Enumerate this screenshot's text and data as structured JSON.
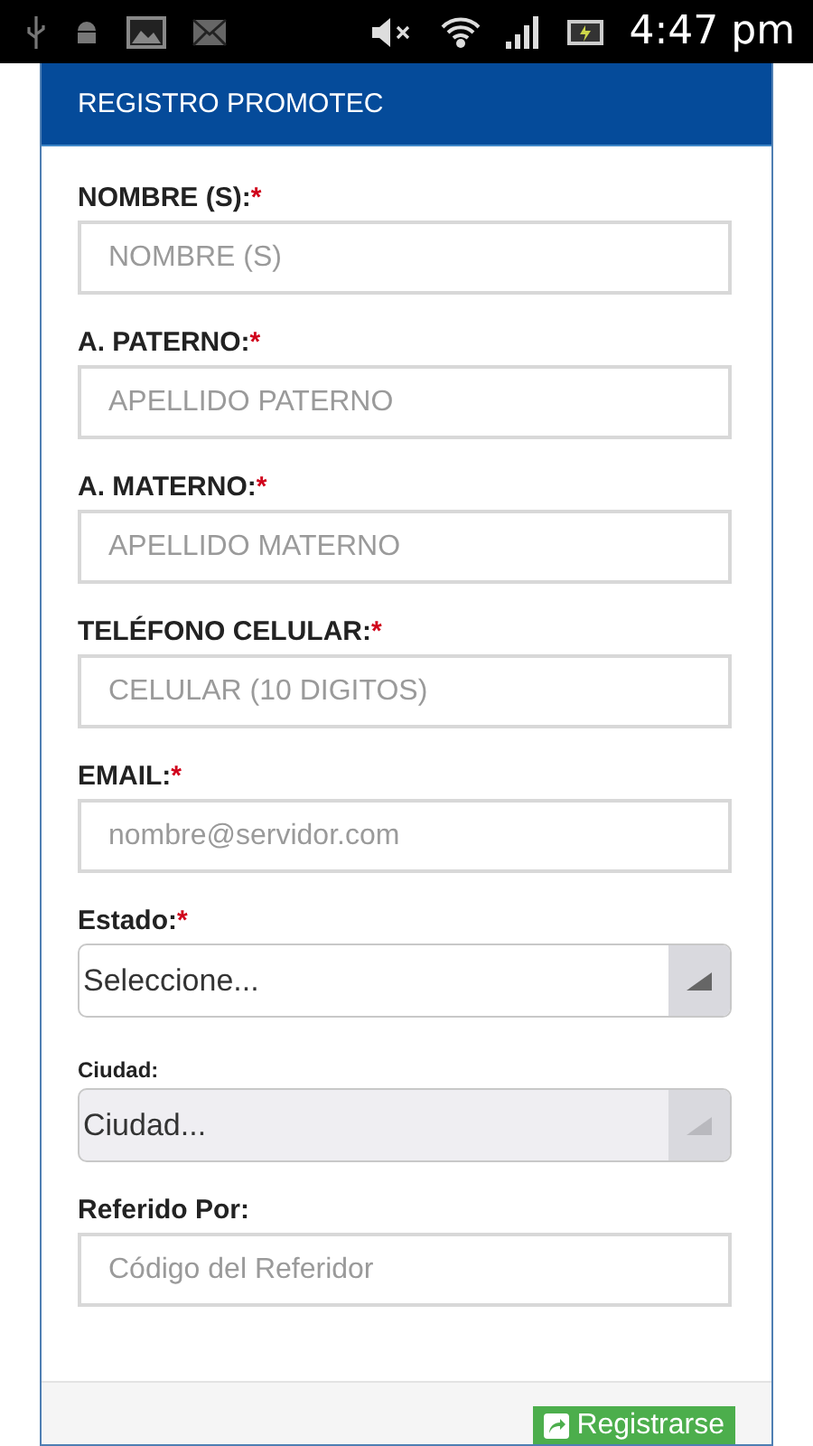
{
  "status_bar": {
    "time": "4:47 pm"
  },
  "panel": {
    "title": "REGISTRO PROMOTEC"
  },
  "fields": [
    {
      "kind": "text",
      "label": "NOMBRE (S):",
      "mark": "*",
      "placeholder": "NOMBRE (S)"
    },
    {
      "kind": "text",
      "label": "A. PATERNO:",
      "mark": "*",
      "placeholder": "APELLIDO PATERNO"
    },
    {
      "kind": "text",
      "label": "A. MATERNO:",
      "mark": "*",
      "placeholder": "APELLIDO MATERNO"
    },
    {
      "kind": "text",
      "label": "TELÉFONO CELULAR:",
      "mark": "*",
      "placeholder": "CELULAR (10 DIGITOS)"
    },
    {
      "kind": "text",
      "label": "EMAIL:",
      "mark": "*",
      "placeholder": "nombre@servidor.com"
    },
    {
      "kind": "select",
      "label": "Estado:",
      "mark": "*",
      "value": "Seleccione...",
      "disabled": false
    },
    {
      "kind": "select",
      "label": "Ciudad:",
      "value": "Ciudad...",
      "disabled": true
    },
    {
      "kind": "text",
      "label": "Referido Por:",
      "placeholder": "Código del Referidor"
    }
  ],
  "submit": {
    "label": "Registrarse"
  }
}
